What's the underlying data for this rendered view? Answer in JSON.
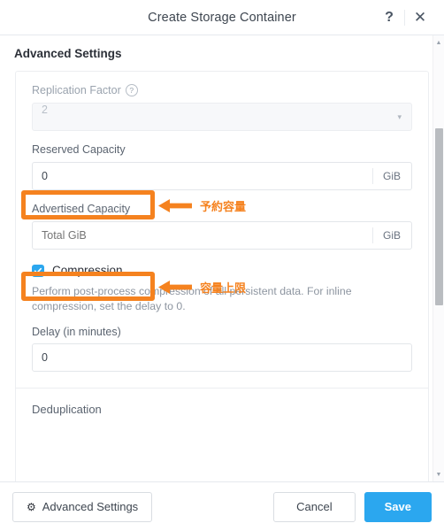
{
  "header": {
    "title": "Create Storage Container",
    "help_icon": "question-mark-icon",
    "close_icon": "close-icon",
    "help_label": "?",
    "close_label": "✕"
  },
  "body": {
    "section_title": "Advanced Settings",
    "fields": {
      "replication_factor": {
        "label": "Replication Factor",
        "info_icon": "info-icon",
        "info_glyph": "?",
        "value": "2",
        "disabled": true,
        "caret": "▾"
      },
      "reserved_capacity": {
        "label": "Reserved Capacity",
        "value": "0",
        "suffix": "GiB",
        "placeholder": ""
      },
      "advertised_capacity": {
        "label": "Advertised Capacity",
        "value": "",
        "placeholder": "Total GiB",
        "suffix": "GiB"
      },
      "compression": {
        "label": "Compression",
        "checked": true,
        "check_glyph": "✓",
        "help_text": "Perform post-process compression of all persistent data. For inline compression, set the delay to 0.",
        "delay_label": "Delay (in minutes)",
        "delay_value": "0"
      },
      "deduplication": {
        "label": "Deduplication"
      }
    }
  },
  "annotations": {
    "color": "#f5821f",
    "items": [
      {
        "target": "reserved-capacity-label",
        "text": "予約容量",
        "arrow": "left-arrow-icon"
      },
      {
        "target": "advertised-capacity-label",
        "text": "容量上限",
        "arrow": "left-arrow-icon"
      }
    ]
  },
  "scrollbar": {
    "up_glyph": "▲",
    "down_glyph": "▼"
  },
  "footer": {
    "advanced_settings_label": "Advanced Settings",
    "gear_icon": "gear-icon",
    "gear_glyph": "⚙",
    "cancel_label": "Cancel",
    "save_label": "Save",
    "save_color": "#2ba7ef"
  }
}
